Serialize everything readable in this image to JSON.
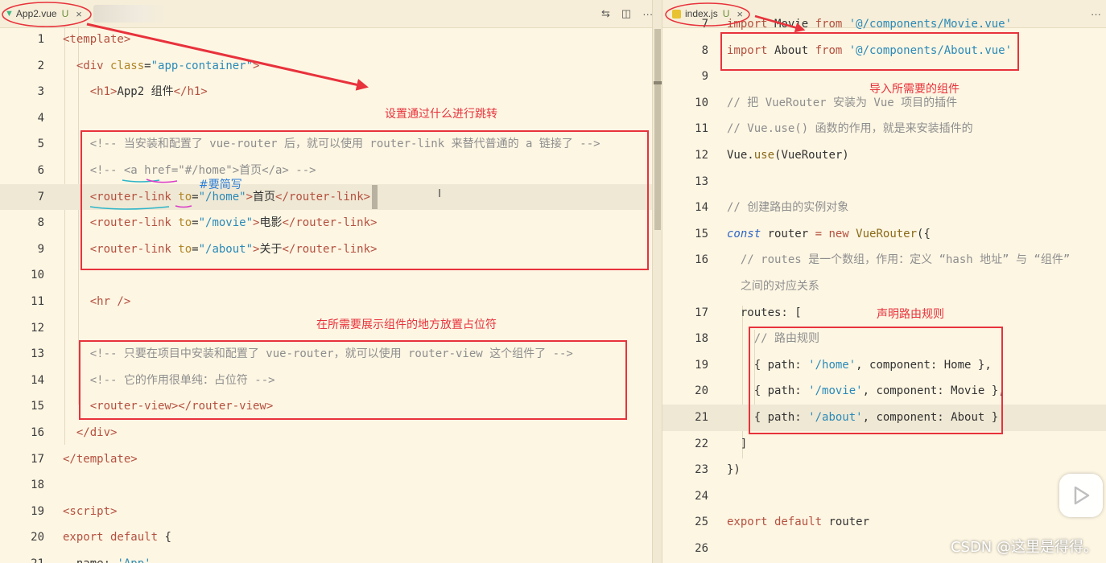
{
  "left_tab": {
    "name": "App2.vue",
    "status": "U",
    "close": "×"
  },
  "right_tab": {
    "name": "index.js",
    "status": "U",
    "close": "×"
  },
  "toolbar": {
    "compare": "⇆",
    "split": "◫",
    "more": "···"
  },
  "left_lines": [
    {
      "n": "1",
      "parts": [
        [
          "tg",
          "<template>"
        ]
      ]
    },
    {
      "n": "2",
      "parts": [
        [
          "",
          "  "
        ],
        [
          "tg",
          "<div "
        ],
        [
          "at",
          "class"
        ],
        [
          "",
          "="
        ],
        [
          "st",
          "\"app-container\""
        ],
        [
          "tg",
          ">"
        ]
      ]
    },
    {
      "n": "3",
      "parts": [
        [
          "",
          "    "
        ],
        [
          "tg",
          "<h1>"
        ],
        [
          "",
          "App2 组件"
        ],
        [
          "tg",
          "</h1>"
        ]
      ]
    },
    {
      "n": "4",
      "parts": []
    },
    {
      "n": "5",
      "parts": [
        [
          "",
          "    "
        ],
        [
          "cm",
          "<!-- 当安装和配置了 vue-router 后，就可以使用 router-link 来替代普通的 a 链接了 -->"
        ]
      ]
    },
    {
      "n": "6",
      "parts": [
        [
          "",
          "    "
        ],
        [
          "cm",
          "<!-- <a href=\"#/home\">首页</a> -->"
        ]
      ]
    },
    {
      "n": "7",
      "parts": [
        [
          "",
          "    "
        ],
        [
          "tg",
          "<router-link "
        ],
        [
          "at",
          "to"
        ],
        [
          "",
          "="
        ],
        [
          "st",
          "\"/home\""
        ],
        [
          "tg",
          ">"
        ],
        [
          "",
          "首页"
        ],
        [
          "tg",
          "</router-link>"
        ]
      ],
      "cur": true
    },
    {
      "n": "8",
      "parts": [
        [
          "",
          "    "
        ],
        [
          "tg",
          "<router-link "
        ],
        [
          "at",
          "to"
        ],
        [
          "",
          "="
        ],
        [
          "st",
          "\"/movie\""
        ],
        [
          "tg",
          ">"
        ],
        [
          "",
          "电影"
        ],
        [
          "tg",
          "</router-link>"
        ]
      ]
    },
    {
      "n": "9",
      "parts": [
        [
          "",
          "    "
        ],
        [
          "tg",
          "<router-link "
        ],
        [
          "at",
          "to"
        ],
        [
          "",
          "="
        ],
        [
          "st",
          "\"/about\""
        ],
        [
          "tg",
          ">"
        ],
        [
          "",
          "关于"
        ],
        [
          "tg",
          "</router-link>"
        ]
      ]
    },
    {
      "n": "10",
      "parts": []
    },
    {
      "n": "11",
      "parts": [
        [
          "",
          "    "
        ],
        [
          "tg",
          "<hr />"
        ]
      ]
    },
    {
      "n": "12",
      "parts": []
    },
    {
      "n": "13",
      "parts": [
        [
          "",
          "    "
        ],
        [
          "cm",
          "<!-- 只要在项目中安装和配置了 vue-router，就可以使用 router-view 这个组件了 -->"
        ]
      ]
    },
    {
      "n": "14",
      "parts": [
        [
          "",
          "    "
        ],
        [
          "cm",
          "<!-- 它的作用很单纯：占位符 -->"
        ]
      ]
    },
    {
      "n": "15",
      "parts": [
        [
          "",
          "    "
        ],
        [
          "tg",
          "<router-view></router-view>"
        ]
      ]
    },
    {
      "n": "16",
      "parts": [
        [
          "",
          "  "
        ],
        [
          "tg",
          "</div>"
        ]
      ]
    },
    {
      "n": "17",
      "parts": [
        [
          "tg",
          "</template>"
        ]
      ]
    },
    {
      "n": "18",
      "parts": []
    },
    {
      "n": "19",
      "parts": [
        [
          "tg",
          "<script>"
        ]
      ]
    },
    {
      "n": "20",
      "parts": [
        [
          "kw",
          "export default "
        ],
        [
          "",
          "{"
        ]
      ]
    },
    {
      "n": "21",
      "parts": [
        [
          "",
          "  name: "
        ],
        [
          "st",
          "'App'"
        ],
        [
          "",
          ","
        ]
      ]
    }
  ],
  "right_lines": [
    {
      "n": "7",
      "parts": [
        [
          "kw",
          "import "
        ],
        [
          "",
          "Movie "
        ],
        [
          "kw",
          "from "
        ],
        [
          "st",
          "'@/components/Movie.vue'"
        ]
      ]
    },
    {
      "n": "8",
      "parts": [
        [
          "kw",
          "import "
        ],
        [
          "",
          "About "
        ],
        [
          "kw",
          "from "
        ],
        [
          "st",
          "'@/components/About.vue'"
        ]
      ]
    },
    {
      "n": "9",
      "parts": []
    },
    {
      "n": "10",
      "parts": [
        [
          "cm",
          "// 把 VueRouter 安装为 Vue 项目的插件"
        ]
      ]
    },
    {
      "n": "11",
      "parts": [
        [
          "cm",
          "// Vue.use() 函数的作用，就是来安装插件的"
        ]
      ]
    },
    {
      "n": "12",
      "parts": [
        [
          "",
          "Vue."
        ],
        [
          "fn",
          "use"
        ],
        [
          "",
          "(VueRouter)"
        ]
      ]
    },
    {
      "n": "13",
      "parts": []
    },
    {
      "n": "14",
      "parts": [
        [
          "cm",
          "// 创建路由的实例对象"
        ]
      ]
    },
    {
      "n": "15",
      "parts": [
        [
          "kwi",
          "const "
        ],
        [
          "",
          "router "
        ],
        [
          "kw",
          "= new "
        ],
        [
          "fn",
          "VueRouter"
        ],
        [
          "",
          "({"
        ]
      ]
    },
    {
      "n": "16",
      "parts": [
        [
          "",
          "  "
        ],
        [
          "cm",
          "// routes 是一个数组，作用：定义 “hash 地址” 与 “组件”"
        ]
      ]
    },
    {
      "n": "",
      "parts": [
        [
          "",
          "  "
        ],
        [
          "cm",
          "之间的对应关系"
        ]
      ]
    },
    {
      "n": "17",
      "parts": [
        [
          "",
          "  routes: ["
        ]
      ]
    },
    {
      "n": "18",
      "parts": [
        [
          "",
          "    "
        ],
        [
          "cm",
          "// 路由规则"
        ]
      ]
    },
    {
      "n": "19",
      "parts": [
        [
          "",
          "    { path: "
        ],
        [
          "st",
          "'/home'"
        ],
        [
          "",
          ", component: Home },"
        ]
      ]
    },
    {
      "n": "20",
      "parts": [
        [
          "",
          "    { path: "
        ],
        [
          "st",
          "'/movie'"
        ],
        [
          "",
          ", component: Movie },"
        ]
      ]
    },
    {
      "n": "21",
      "parts": [
        [
          "",
          "    { path: "
        ],
        [
          "st",
          "'/about'"
        ],
        [
          "",
          ", component: About }"
        ]
      ],
      "cur": true
    },
    {
      "n": "22",
      "parts": [
        [
          "",
          "  ]"
        ]
      ]
    },
    {
      "n": "23",
      "parts": [
        [
          "",
          "})"
        ]
      ]
    },
    {
      "n": "24",
      "parts": []
    },
    {
      "n": "25",
      "parts": [
        [
          "kw",
          "export default "
        ],
        [
          "",
          "router"
        ]
      ]
    },
    {
      "n": "26",
      "parts": []
    }
  ],
  "annotations": {
    "jump_setting": "设置通过什么进行跳转",
    "shorthand": "#要简写",
    "placeholder": "在所需要展示组件的地方放置占位符",
    "import_components": "导入所需要的组件",
    "declare_rules": "声明路由规则"
  },
  "watermark": "CSDN @这里是得得。",
  "colors": {
    "annotation": "#e8323c",
    "note_blue": "#2b7cd6",
    "background": "#fdf6e3"
  }
}
